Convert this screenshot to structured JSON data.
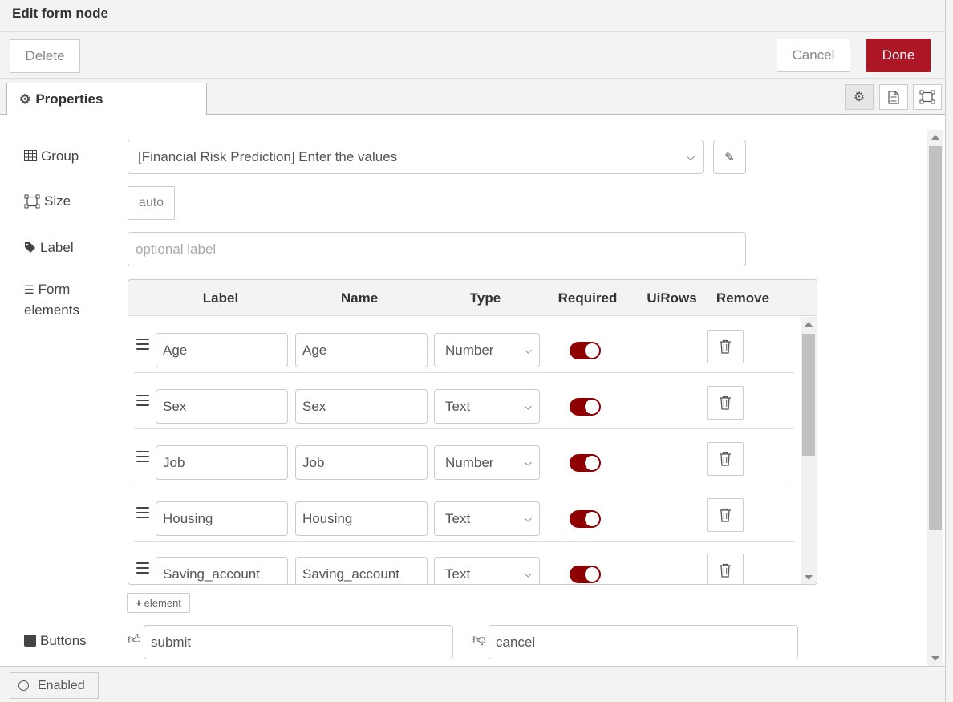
{
  "tray": {
    "title": "Edit form node"
  },
  "toolbar": {
    "delete_label": "Delete",
    "cancel_label": "Cancel",
    "done_label": "Done"
  },
  "tabs": {
    "properties_label": "Properties"
  },
  "fields": {
    "group_label": "Group",
    "group_value": "[Financial Risk Prediction] Enter the values",
    "size_label": "Size",
    "size_value": "auto",
    "label_label": "Label",
    "label_placeholder": "optional label",
    "form_elements_label_1": "Form",
    "form_elements_label_2": "elements"
  },
  "table": {
    "headers": {
      "label": "Label",
      "name": "Name",
      "type": "Type",
      "required": "Required",
      "uirows": "UiRows",
      "remove": "Remove"
    },
    "rows": [
      {
        "label": "Age",
        "name": "Age",
        "type": "Number",
        "required": true
      },
      {
        "label": "Sex",
        "name": "Sex",
        "type": "Text",
        "required": true
      },
      {
        "label": "Job",
        "name": "Job",
        "type": "Number",
        "required": true
      },
      {
        "label": "Housing",
        "name": "Housing",
        "type": "Text",
        "required": true
      },
      {
        "label": "Saving_account",
        "name": "Saving_account",
        "type": "Text",
        "required": true
      }
    ],
    "add_label": "element"
  },
  "buttons": {
    "label": "Buttons",
    "submit_value": "submit",
    "cancel_value": "cancel"
  },
  "footer": {
    "enabled_label": "Enabled"
  },
  "colors": {
    "accent": "#ad1625",
    "toggle_on": "#8f0000"
  }
}
